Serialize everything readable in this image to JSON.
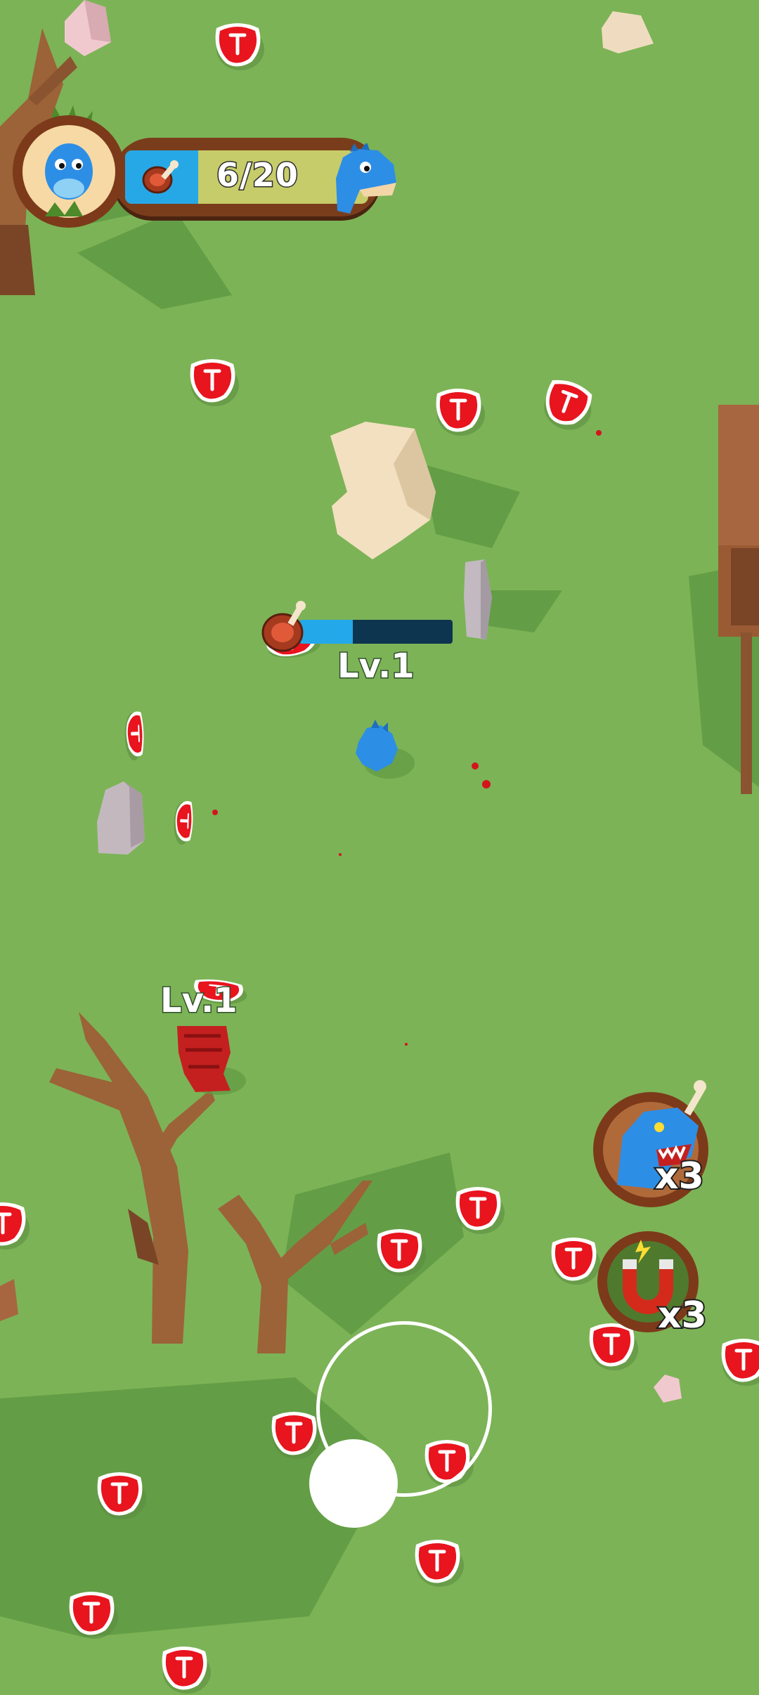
{
  "hud": {
    "meat_progress": "6/20",
    "collected": 6,
    "target": 20,
    "player_avatar": "blue-baby-dino-icon",
    "goal_avatar": "blue-adult-dino-icon",
    "meat_icon": "meat-icon"
  },
  "player": {
    "level_label": "Lv.1",
    "growth_fraction": 0.35,
    "color": "#2d8ee6"
  },
  "enemy": {
    "level_label": "Lv.1",
    "color": "#c42020"
  },
  "powerups": [
    {
      "name": "dino-rage",
      "icon": "angry-dino-icon",
      "count_label": "x3"
    },
    {
      "name": "magnet",
      "icon": "magnet-icon",
      "count_label": "x3"
    }
  ],
  "joystick": {
    "ring_icon": "joystick-ring",
    "knob_icon": "joystick-knob"
  },
  "colors": {
    "ground": "#7cb356",
    "meat_red": "#e8141e",
    "hud_wood": "#7a3d1b",
    "hud_bar_fill": "#27a8e6"
  }
}
